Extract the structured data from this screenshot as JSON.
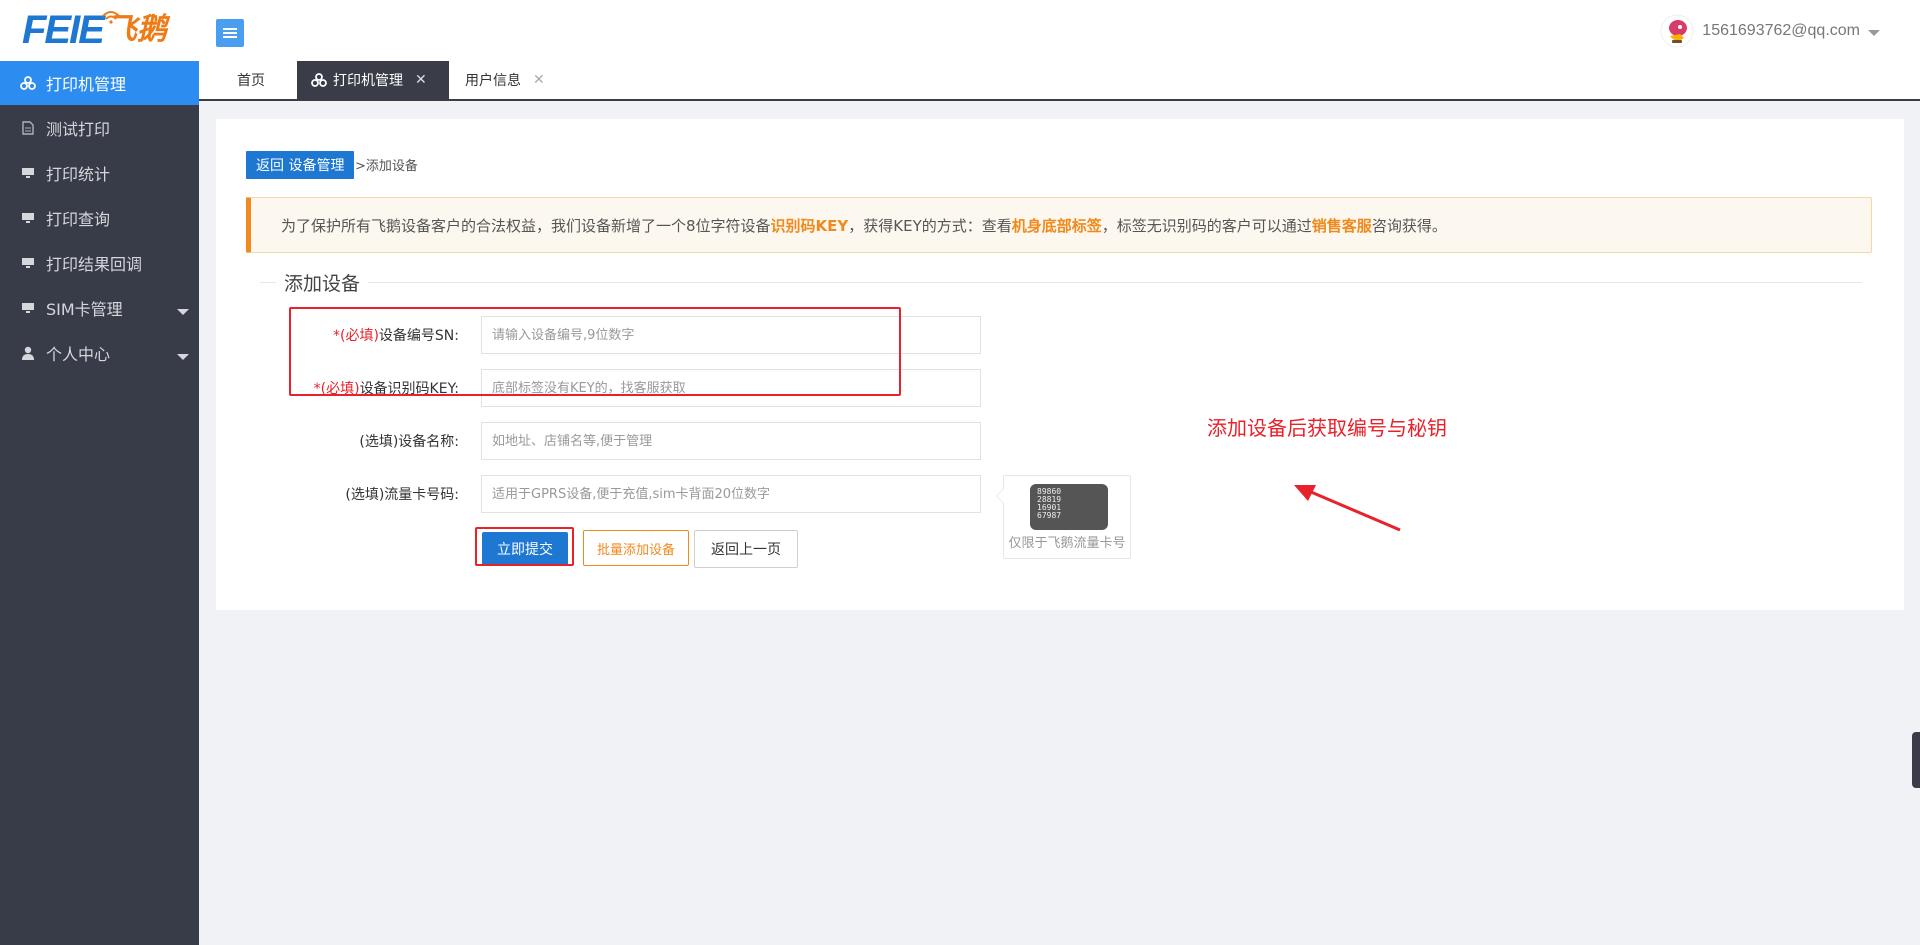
{
  "header": {
    "logo_en": "FEIE",
    "logo_cn": "飞鹅",
    "user_email": "1561693762@qq.com"
  },
  "sidebar": {
    "items": [
      {
        "label": "打印机管理",
        "icon": "cluster-icon",
        "active": true
      },
      {
        "label": "测试打印",
        "icon": "document-icon"
      },
      {
        "label": "打印统计",
        "icon": "monitor-icon"
      },
      {
        "label": "打印查询",
        "icon": "monitor-icon"
      },
      {
        "label": "打印结果回调",
        "icon": "monitor-icon"
      },
      {
        "label": "SIM卡管理",
        "icon": "monitor-icon",
        "has_children": true
      },
      {
        "label": "个人中心",
        "icon": "user-icon",
        "has_children": true
      }
    ]
  },
  "tabs": [
    {
      "label": "首页"
    },
    {
      "label": "打印机管理",
      "active": true
    },
    {
      "label": "用户信息"
    }
  ],
  "breadcrumb": {
    "back_label": "返回 设备管理",
    "current": ">添加设备"
  },
  "notice": {
    "part1": "为了保护所有飞鹅设备客户的合法权益，我们设备新增了一个8位字符设备",
    "hl1": "识别码KEY",
    "part2": "，获得KEY的方式：查看",
    "hl2": "机身底部标签",
    "part3": "，标签无识别码的客户可以通过",
    "hl3": "销售客服",
    "part4": "咨询获得。"
  },
  "form": {
    "title": "添加设备",
    "fields": [
      {
        "req": "*(必填)",
        "label": "设备编号SN:",
        "placeholder": "请输入设备编号,9位数字"
      },
      {
        "req": "*(必填)",
        "label": "设备识别码KEY:",
        "placeholder": "底部标签没有KEY的，找客服获取"
      },
      {
        "req": "",
        "label": "(选填)设备名称:",
        "placeholder": "如地址、店铺名等,便于管理"
      },
      {
        "req": "",
        "label": "(选填)流量卡号码:",
        "placeholder": "适用于GPRS设备,便于充值,sim卡背面20位数字"
      }
    ],
    "submit_label": "立即提交",
    "batch_label": "批量添加设备",
    "back_label": "返回上一页"
  },
  "sim_tooltip": {
    "card_lines": [
      "89860",
      "28819",
      "16901",
      "67987"
    ],
    "caption": "仅限于飞鹅流量卡号"
  },
  "annotation": {
    "text": "添加设备后获取编号与秘钥",
    "color": "#e8212a"
  },
  "colors": {
    "primary": "#1e78d2",
    "accent": "#f08a1e",
    "sidebar_bg": "#383b48",
    "sidebar_active": "#2d8cf0"
  }
}
